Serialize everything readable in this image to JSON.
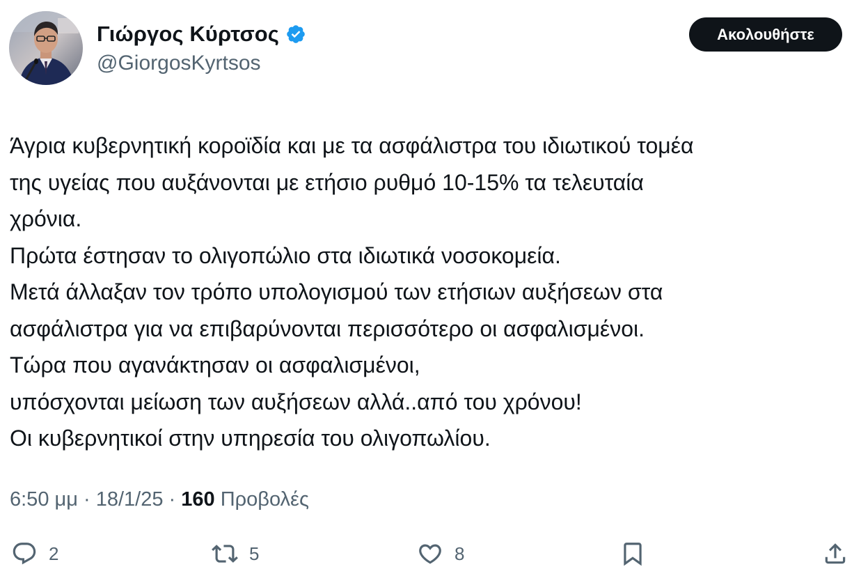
{
  "author": {
    "name": "Γιώργος Κύρτσος",
    "handle": "@GiorgosKyrtsos",
    "verified": true
  },
  "follow_button": {
    "label": "Ακολουθήστε"
  },
  "tweet": {
    "lines": [
      "Άγρια κυβερνητική κοροϊδία και με τα ασφάλιστρα του ιδιωτικού τομέα",
      "της υγείας που αυξάνονται με ετήσιο ρυθμό 10-15% τα τελευταία",
      "χρόνια.",
      "Πρώτα έστησαν το ολιγοπώλιο στα ιδιωτικά νοσοκομεία.",
      "Μετά άλλαξαν τον τρόπο υπολογισμού των ετήσιων αυξήσεων στα",
      "ασφάλιστρα για να επιβαρύνονται περισσότερο οι ασφαλισμένοι.",
      "Τώρα που αγανάκτησαν οι ασφαλισμένοι,",
      "υπόσχονται μείωση των αυξήσεων αλλά..από του χρόνου!",
      "Οι κυβερνητικοί στην υπηρεσία του ολιγοπωλίου."
    ]
  },
  "meta": {
    "time": "6:50 μμ",
    "separator": " · ",
    "date": "18/1/25",
    "views_count": "160",
    "views_label": "Προβολές"
  },
  "actions": {
    "reply_count": "2",
    "retweet_count": "5",
    "like_count": "8"
  },
  "icons": {
    "verified": "verified-badge-icon",
    "reply": "reply-icon",
    "retweet": "retweet-icon",
    "like": "heart-icon",
    "bookmark": "bookmark-icon",
    "share": "share-icon"
  },
  "colors": {
    "text_primary": "#0f1419",
    "text_secondary": "#536471",
    "verified_blue": "#1d9bf0",
    "button_bg": "#0f1419",
    "button_text": "#ffffff"
  }
}
